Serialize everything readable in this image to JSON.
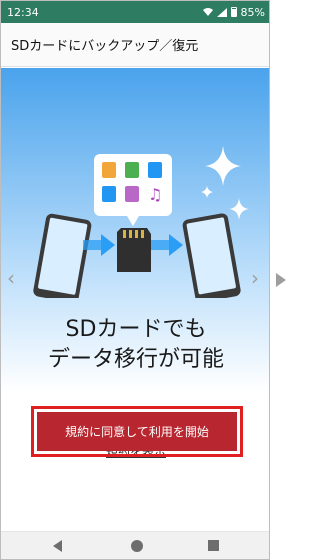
{
  "status_bar": {
    "time": "12:34",
    "battery": "85%",
    "icons": [
      "wifi-icon",
      "signal-icon",
      "battery-icon"
    ]
  },
  "app_bar": {
    "title": "SDカードにバックアップ／復元"
  },
  "carousel": {
    "headline_line1": "SDカードでも",
    "headline_line2": "データ移行が可能",
    "page_count": 2,
    "current_page": 1,
    "nav_icons": [
      "chevron-left-icon",
      "chevron-right-icon"
    ]
  },
  "illustration_icons": [
    "contacts-icon",
    "photos-icon",
    "app-icon",
    "calendar-icon",
    "video-icon",
    "music-icon",
    "phone-icon",
    "sd-card-icon",
    "arrow-right-icon",
    "sparkle-icon"
  ],
  "terms_link": "規約を表示",
  "cta_button": "規約に同意して利用を開始",
  "colors": {
    "status_bar": "#2e7d63",
    "accent_red": "#b8262f",
    "highlight_red": "#e02020",
    "sky_blue": "#4aa3ec"
  },
  "system_nav": [
    "back-icon",
    "home-icon",
    "recents-icon"
  ]
}
